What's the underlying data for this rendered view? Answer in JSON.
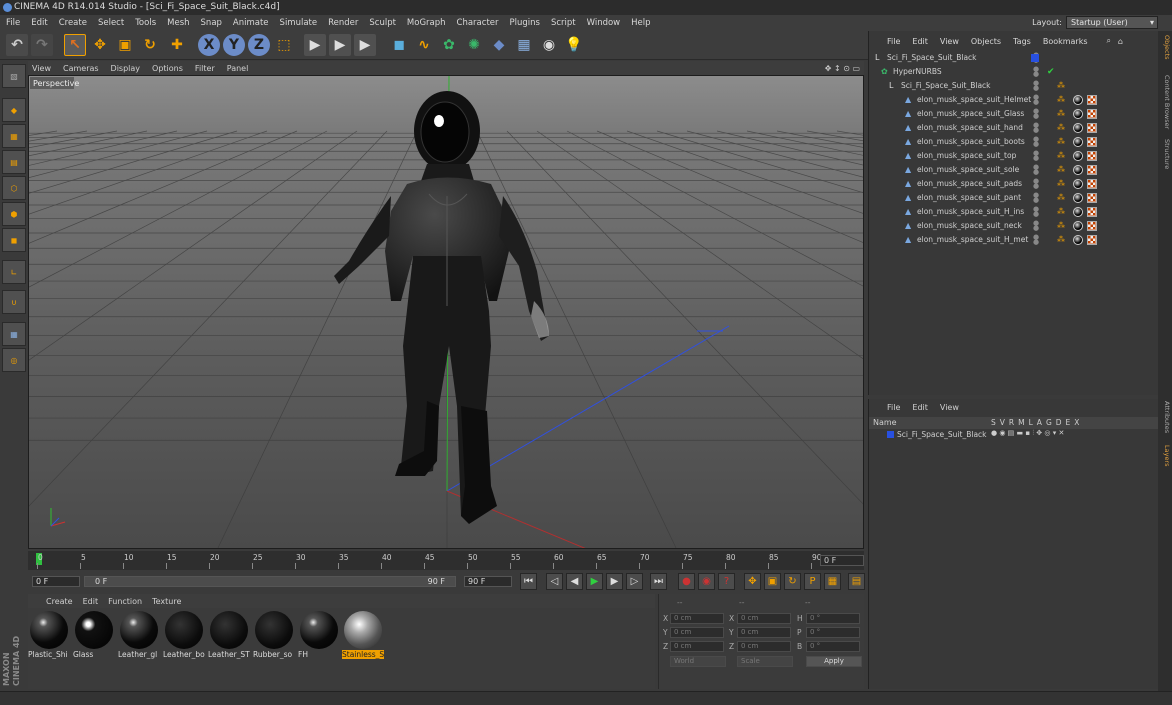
{
  "window": {
    "title": "CINEMA 4D R14.014 Studio - [Sci_Fi_Space_Suit_Black.c4d]"
  },
  "menu": [
    "File",
    "Edit",
    "Create",
    "Select",
    "Tools",
    "Mesh",
    "Snap",
    "Animate",
    "Simulate",
    "Render",
    "Sculpt",
    "MoGraph",
    "Character",
    "Plugins",
    "Script",
    "Window",
    "Help"
  ],
  "layout": {
    "label": "Layout:",
    "value": "Startup (User)"
  },
  "viewport": {
    "menu": [
      "View",
      "Cameras",
      "Display",
      "Options",
      "Filter",
      "Panel"
    ],
    "label": "Perspective"
  },
  "timeline": {
    "ticks": [
      "0",
      "5",
      "10",
      "15",
      "20",
      "25",
      "30",
      "35",
      "40",
      "45",
      "50",
      "55",
      "60",
      "65",
      "70",
      "75",
      "80",
      "85",
      "90"
    ],
    "current_frame": "0 F"
  },
  "transport": {
    "start": "0 F",
    "slider_start": "0 F",
    "slider_end": "90 F",
    "end": "90 F"
  },
  "materials": {
    "menu": [
      "Create",
      "Edit",
      "Function",
      "Texture"
    ],
    "items": [
      "Plastic_Shi",
      "Glass",
      "Leather_gl",
      "Leather_bo",
      "Leather_ST",
      "Rubber_so",
      "FH",
      "Stainless_S"
    ],
    "selected": "Stainless_S"
  },
  "coords": {
    "header": [
      "--",
      "--",
      "--"
    ],
    "labels": [
      "X",
      "Y",
      "Z",
      "X",
      "Y",
      "Z",
      "H",
      "P",
      "B"
    ],
    "pos": [
      "0 cm",
      "0 cm",
      "0 cm"
    ],
    "size": [
      "0 cm",
      "0 cm",
      "0 cm"
    ],
    "rot": [
      "0 °",
      "0 °",
      "0 °"
    ],
    "mode1": "World",
    "mode2": "Scale",
    "apply": "Apply"
  },
  "object_manager": {
    "menu": [
      "File",
      "Edit",
      "View",
      "Objects",
      "Tags",
      "Bookmarks"
    ],
    "objects": [
      {
        "name": "Sci_Fi_Space_Suit_Black",
        "level": 0
      },
      {
        "name": "HyperNURBS",
        "level": 1
      },
      {
        "name": "Sci_Fi_Space_Suit_Black",
        "level": 2
      },
      {
        "name": "elon_musk_space_suit_Helmet",
        "level": 3
      },
      {
        "name": "elon_musk_space_suit_Glass",
        "level": 3
      },
      {
        "name": "elon_musk_space_suit_hand",
        "level": 3
      },
      {
        "name": "elon_musk_space_suit_boots",
        "level": 3
      },
      {
        "name": "elon_musk_space_suit_top",
        "level": 3
      },
      {
        "name": "elon_musk_space_suit_sole",
        "level": 3
      },
      {
        "name": "elon_musk_space_suit_pads",
        "level": 3
      },
      {
        "name": "elon_musk_space_suit_pant",
        "level": 3
      },
      {
        "name": "elon_musk_space_suit_H_ins",
        "level": 3
      },
      {
        "name": "elon_musk_space_suit_neck",
        "level": 3
      },
      {
        "name": "elon_musk_space_suit_H_met",
        "level": 3
      }
    ]
  },
  "layer_manager": {
    "menu": [
      "File",
      "Edit",
      "View"
    ],
    "columns": {
      "name": "Name",
      "flags": [
        "S",
        "V",
        "R",
        "M",
        "L",
        "A",
        "G",
        "D",
        "E",
        "X"
      ]
    },
    "row": "Sci_Fi_Space_Suit_Black"
  },
  "side_tabs": [
    "Objects",
    "Content Browser",
    "Structure",
    "Attributes",
    "Layers"
  ],
  "brand": "MAXON CINEMA 4D",
  "colors": {
    "accent": "#f0a000",
    "axis_x": "#d03030",
    "axis_y": "#30c030",
    "axis_z": "#3050e0",
    "layer_blue": "#2850e0"
  }
}
